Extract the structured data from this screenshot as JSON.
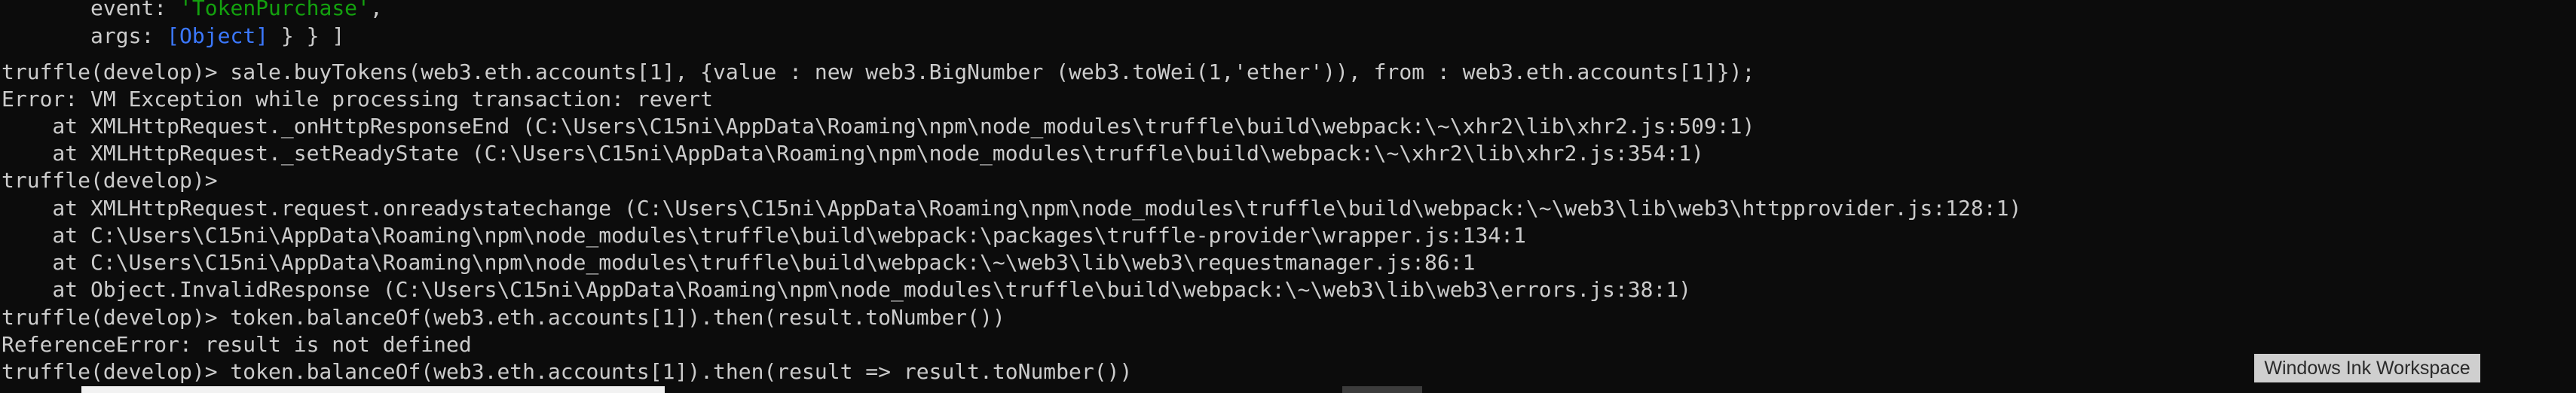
{
  "terminal": {
    "line_0": {
      "indent": "       ",
      "key": "event: ",
      "value": "'TokenPurchase'",
      "tail": ","
    },
    "line_1": {
      "indent": "       ",
      "key": "args: ",
      "value": "[Object]",
      "tail": " } } ]"
    },
    "line_2": "truffle(develop)> sale.buyTokens(web3.eth.accounts[1], {value : new web3.BigNumber (web3.toWei(1,'ether')), from : web3.eth.accounts[1]});",
    "line_3": "Error: VM Exception while processing transaction: revert",
    "line_4": "    at XMLHttpRequest._onHttpResponseEnd (C:\\Users\\C15ni\\AppData\\Roaming\\npm\\node_modules\\truffle\\build\\webpack:\\~\\xhr2\\lib\\xhr2.js:509:1)",
    "line_5": "    at XMLHttpRequest._setReadyState (C:\\Users\\C15ni\\AppData\\Roaming\\npm\\node_modules\\truffle\\build\\webpack:\\~\\xhr2\\lib\\xhr2.js:354:1)",
    "line_6": "truffle(develop)>",
    "line_7": "    at XMLHttpRequest.request.onreadystatechange (C:\\Users\\C15ni\\AppData\\Roaming\\npm\\node_modules\\truffle\\build\\webpack:\\~\\web3\\lib\\web3\\httpprovider.js:128:1)",
    "line_8": "    at C:\\Users\\C15ni\\AppData\\Roaming\\npm\\node_modules\\truffle\\build\\webpack:\\packages\\truffle-provider\\wrapper.js:134:1",
    "line_9": "    at C:\\Users\\C15ni\\AppData\\Roaming\\npm\\node_modules\\truffle\\build\\webpack:\\~\\web3\\lib\\web3\\requestmanager.js:86:1",
    "line_10": "    at Object.InvalidResponse (C:\\Users\\C15ni\\AppData\\Roaming\\npm\\node_modules\\truffle\\build\\webpack:\\~\\web3\\lib\\web3\\errors.js:38:1)",
    "line_11": "truffle(develop)> token.balanceOf(web3.eth.accounts[1]).then(result.toNumber())",
    "line_12": "ReferenceError: result is not defined",
    "line_13": "truffle(develop)> token.balanceOf(web3.eth.accounts[1]).then(result => result.toNumber())"
  },
  "overlay": {
    "ink_workspace_label": "Windows Ink Workspace"
  },
  "colors": {
    "background": "#0c0c0c",
    "text": "#cccccc",
    "string": "#13a10e",
    "object": "#3b78ff"
  }
}
